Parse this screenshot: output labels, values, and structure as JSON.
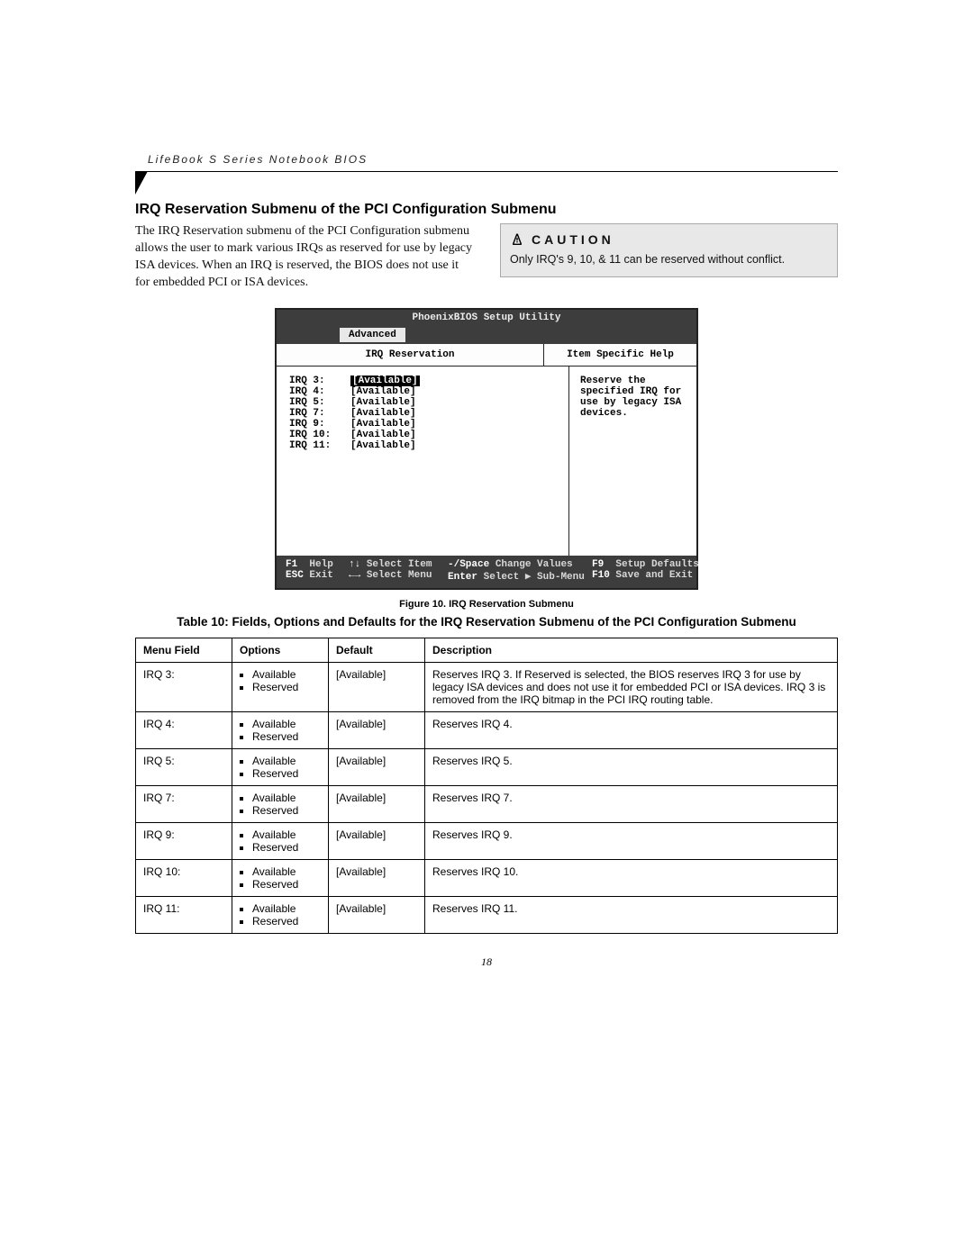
{
  "running_head": "LifeBook S Series Notebook BIOS",
  "section_title": "IRQ Reservation Submenu of the PCI Configuration Submenu",
  "intro_paragraph": "The IRQ Reservation submenu of the PCI Configuration submenu allows the user to mark various IRQs as reserved for use by legacy ISA devices. When an IRQ is reserved, the BIOS does not use it for embedded PCI or ISA devices.",
  "caution": {
    "label": "CAUTION",
    "text": "Only IRQ's 9, 10, & 11 can be reserved without conflict."
  },
  "bios": {
    "title": "PhoenixBIOS Setup Utility",
    "tab": "Advanced",
    "pane_left_title": "IRQ Reservation",
    "pane_right_title": "Item Specific Help",
    "help_text": "Reserve the specified IRQ for use by legacy ISA devices.",
    "irqs": [
      {
        "label": "IRQ 3:",
        "value": "[Available]",
        "selected": true
      },
      {
        "label": "IRQ 4:",
        "value": "[Available]",
        "selected": false
      },
      {
        "label": "IRQ 5:",
        "value": "[Available]",
        "selected": false
      },
      {
        "label": "IRQ 7:",
        "value": "[Available]",
        "selected": false
      },
      {
        "label": "IRQ 9:",
        "value": "[Available]",
        "selected": false
      },
      {
        "label": "IRQ 10:",
        "value": "[Available]",
        "selected": false
      },
      {
        "label": "IRQ 11:",
        "value": "[Available]",
        "selected": false
      }
    ],
    "footer": {
      "f1": "F1",
      "f1_action": "Help",
      "updown": "↑↓",
      "updown_action": "Select Item",
      "minus_space": "-/Space",
      "minus_space_action": "Change Values",
      "f9": "F9",
      "f9_action": "Setup Defaults",
      "esc": "ESC",
      "esc_action": "Exit",
      "leftright": "←→",
      "leftright_action": "Select Menu",
      "enter": "Enter",
      "enter_action": "Select ▶ Sub-Menu",
      "f10": "F10",
      "f10_action": "Save and Exit"
    }
  },
  "figure_caption": "Figure 10.   IRQ Reservation Submenu",
  "table_title": "Table 10: Fields, Options and Defaults for the IRQ Reservation Submenu of the PCI Configuration Submenu",
  "table": {
    "headers": [
      "Menu Field",
      "Options",
      "Default",
      "Description"
    ],
    "option_pair": [
      "Available",
      "Reserved"
    ],
    "rows": [
      {
        "field": "IRQ 3:",
        "default": "[Available]",
        "desc": "Reserves IRQ 3. If Reserved is selected, the BIOS reserves IRQ 3 for use by legacy ISA devices and does not use it for embedded PCI or ISA devices. IRQ 3 is removed from the IRQ bitmap in the PCI IRQ routing table."
      },
      {
        "field": "IRQ 4:",
        "default": "[Available]",
        "desc": "Reserves IRQ 4."
      },
      {
        "field": "IRQ 5:",
        "default": "[Available]",
        "desc": "Reserves IRQ 5."
      },
      {
        "field": "IRQ 7:",
        "default": "[Available]",
        "desc": "Reserves IRQ 7."
      },
      {
        "field": "IRQ 9:",
        "default": "[Available]",
        "desc": "Reserves IRQ 9."
      },
      {
        "field": "IRQ 10:",
        "default": "[Available]",
        "desc": "Reserves IRQ 10."
      },
      {
        "field": "IRQ 11:",
        "default": "[Available]",
        "desc": "Reserves IRQ 11."
      }
    ]
  },
  "page_number": "18"
}
